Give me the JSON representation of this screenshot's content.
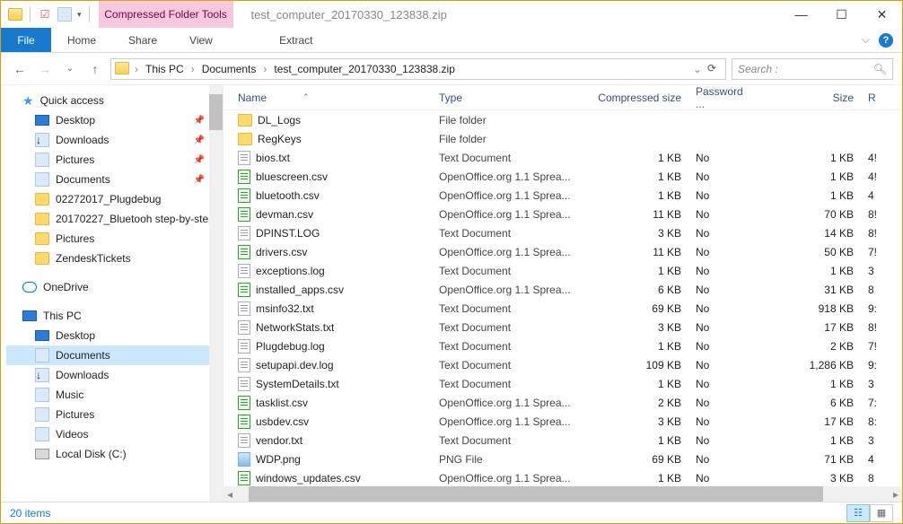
{
  "window": {
    "context_tab": "Compressed Folder Tools",
    "title": "test_computer_20170330_123838.zip"
  },
  "ribbon": {
    "file": "File",
    "home": "Home",
    "share": "Share",
    "view": "View",
    "extract": "Extract"
  },
  "breadcrumb": {
    "seg1": "This PC",
    "seg2": "Documents",
    "seg3": "test_computer_20170330_123838.zip"
  },
  "search": {
    "placeholder": "Search :"
  },
  "nav": {
    "quick_access": "Quick access",
    "desktop": "Desktop",
    "downloads": "Downloads",
    "pictures": "Pictures",
    "documents": "Documents",
    "f1": "02272017_Plugdebug",
    "f2": "20170227_Bluetooh step-by-step",
    "f3": "Pictures",
    "f4": "ZendeskTickets",
    "onedrive": "OneDrive",
    "thispc": "This PC",
    "pc_desktop": "Desktop",
    "pc_documents": "Documents",
    "pc_downloads": "Downloads",
    "pc_music": "Music",
    "pc_pictures": "Pictures",
    "pc_videos": "Videos",
    "pc_localdisk": "Local Disk (C:)"
  },
  "columns": {
    "name": "Name",
    "type": "Type",
    "compressed": "Compressed size",
    "password": "Password ...",
    "size": "Size",
    "rest": "R"
  },
  "files": [
    {
      "icon": "folder",
      "name": "DL_Logs",
      "type": "File folder",
      "comp": "",
      "pass": "",
      "size": "",
      "r": ""
    },
    {
      "icon": "folder",
      "name": "RegKeys",
      "type": "File folder",
      "comp": "",
      "pass": "",
      "size": "",
      "r": ""
    },
    {
      "icon": "txt",
      "name": "bios.txt",
      "type": "Text Document",
      "comp": "1 KB",
      "pass": "No",
      "size": "1 KB",
      "r": "4!"
    },
    {
      "icon": "csv",
      "name": "bluescreen.csv",
      "type": "OpenOffice.org 1.1 Sprea...",
      "comp": "1 KB",
      "pass": "No",
      "size": "1 KB",
      "r": "4!"
    },
    {
      "icon": "csv",
      "name": "bluetooth.csv",
      "type": "OpenOffice.org 1.1 Sprea...",
      "comp": "1 KB",
      "pass": "No",
      "size": "1 KB",
      "r": "4"
    },
    {
      "icon": "csv",
      "name": "devman.csv",
      "type": "OpenOffice.org 1.1 Sprea...",
      "comp": "11 KB",
      "pass": "No",
      "size": "70 KB",
      "r": "8!"
    },
    {
      "icon": "txt",
      "name": "DPINST.LOG",
      "type": "Text Document",
      "comp": "3 KB",
      "pass": "No",
      "size": "14 KB",
      "r": "8!"
    },
    {
      "icon": "csv",
      "name": "drivers.csv",
      "type": "OpenOffice.org 1.1 Sprea...",
      "comp": "11 KB",
      "pass": "No",
      "size": "50 KB",
      "r": "7!"
    },
    {
      "icon": "txt",
      "name": "exceptions.log",
      "type": "Text Document",
      "comp": "1 KB",
      "pass": "No",
      "size": "1 KB",
      "r": "3"
    },
    {
      "icon": "csv",
      "name": "installed_apps.csv",
      "type": "OpenOffice.org 1.1 Sprea...",
      "comp": "6 KB",
      "pass": "No",
      "size": "31 KB",
      "r": "8"
    },
    {
      "icon": "txt",
      "name": "msinfo32.txt",
      "type": "Text Document",
      "comp": "69 KB",
      "pass": "No",
      "size": "918 KB",
      "r": "9:"
    },
    {
      "icon": "txt",
      "name": "NetworkStats.txt",
      "type": "Text Document",
      "comp": "3 KB",
      "pass": "No",
      "size": "17 KB",
      "r": "8!"
    },
    {
      "icon": "txt",
      "name": "Plugdebug.log",
      "type": "Text Document",
      "comp": "1 KB",
      "pass": "No",
      "size": "2 KB",
      "r": "7!"
    },
    {
      "icon": "txt",
      "name": "setupapi.dev.log",
      "type": "Text Document",
      "comp": "109 KB",
      "pass": "No",
      "size": "1,286 KB",
      "r": "9:"
    },
    {
      "icon": "txt",
      "name": "SystemDetails.txt",
      "type": "Text Document",
      "comp": "1 KB",
      "pass": "No",
      "size": "1 KB",
      "r": "3"
    },
    {
      "icon": "csv",
      "name": "tasklist.csv",
      "type": "OpenOffice.org 1.1 Sprea...",
      "comp": "2 KB",
      "pass": "No",
      "size": "6 KB",
      "r": "7:"
    },
    {
      "icon": "csv",
      "name": "usbdev.csv",
      "type": "OpenOffice.org 1.1 Sprea...",
      "comp": "3 KB",
      "pass": "No",
      "size": "17 KB",
      "r": "8:"
    },
    {
      "icon": "txt",
      "name": "vendor.txt",
      "type": "Text Document",
      "comp": "1 KB",
      "pass": "No",
      "size": "1 KB",
      "r": "3"
    },
    {
      "icon": "png",
      "name": "WDP.png",
      "type": "PNG File",
      "comp": "69 KB",
      "pass": "No",
      "size": "71 KB",
      "r": "4"
    },
    {
      "icon": "csv",
      "name": "windows_updates.csv",
      "type": "OpenOffice.org 1.1 Sprea...",
      "comp": "1 KB",
      "pass": "No",
      "size": "3 KB",
      "r": "8"
    }
  ],
  "status": {
    "count": "20 items"
  }
}
